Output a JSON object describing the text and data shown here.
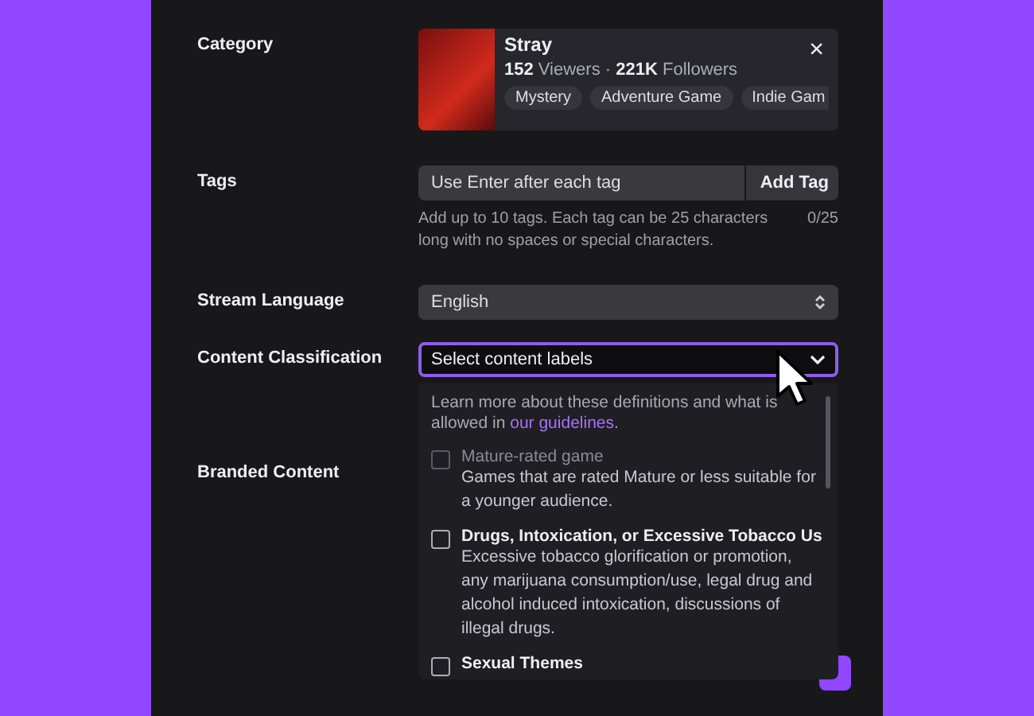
{
  "category": {
    "label": "Category",
    "game": {
      "title": "Stray",
      "viewers": "152",
      "viewers_label": "Viewers",
      "separator": "·",
      "followers": "221K",
      "followers_label": "Followers",
      "tags": [
        "Mystery",
        "Adventure Game",
        "Indie Gam"
      ],
      "close": "×"
    }
  },
  "tags": {
    "label": "Tags",
    "placeholder": "Use Enter after each tag",
    "button": "Add Tag",
    "help": "Add up to 10 tags. Each tag can be 25 characters long with no spaces or special characters.",
    "count": "0/25"
  },
  "language": {
    "label": "Stream Language",
    "value": "English"
  },
  "classification": {
    "label": "Content Classification",
    "placeholder": "Select content labels",
    "expanded": true,
    "intro": "Learn more about these definitions and what is allowed in",
    "link": "our guidelines",
    "intro_end": ".",
    "options": [
      {
        "title": "Mature-rated game",
        "description": "Games that are rated Mature or less suitable for a younger audience.",
        "checked": false,
        "disabled": true
      },
      {
        "title": "Drugs, Intoxication, or Excessive Tobacco Us",
        "description": "Excessive tobacco glorification or promotion, any marijuana consumption/use, legal drug and alcohol induced intoxication, discussions of illegal drugs.",
        "checked": false,
        "disabled": false
      },
      {
        "title": "Sexual Themes",
        "checked": false,
        "disabled": false
      }
    ]
  },
  "branded": {
    "label": "Branded Content"
  }
}
